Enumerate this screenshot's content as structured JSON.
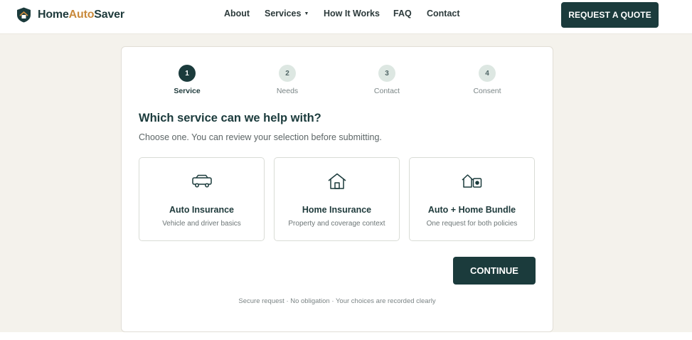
{
  "brand": {
    "name_part1": "Home",
    "name_accent": "Auto",
    "name_part2": "Saver",
    "logo_icon": "shield-house-icon"
  },
  "nav": {
    "items": [
      {
        "label": "About"
      },
      {
        "label": "Services",
        "has_dropdown": true
      },
      {
        "label": "How It Works"
      },
      {
        "label": "FAQ"
      },
      {
        "label": "Contact"
      }
    ],
    "cta_label": "REQUEST A QUOTE"
  },
  "stepper": {
    "current_step": 1,
    "steps": [
      {
        "number": "1",
        "label": "Service"
      },
      {
        "number": "2",
        "label": "Needs"
      },
      {
        "number": "3",
        "label": "Contact"
      },
      {
        "number": "4",
        "label": "Consent"
      }
    ]
  },
  "form": {
    "question": "Which service can we help with?",
    "subtitle": "Choose one. You can review your selection before submitting.",
    "options": [
      {
        "icon": "car-icon",
        "title": "Auto Insurance",
        "description": "Vehicle and driver basics"
      },
      {
        "icon": "house-icon",
        "title": "Home Insurance",
        "description": "Property and coverage context"
      },
      {
        "icon": "house-car-icon",
        "title": "Auto + Home Bundle",
        "description": "One request for both policies"
      }
    ],
    "continue_label": "CONTINUE",
    "footnote": "Secure request · No obligation · Your choices are recorded clearly"
  },
  "colors": {
    "primary": "#1b3b3c",
    "accent": "#c98a3c",
    "background": "#f4f2ec",
    "step_inactive": "#dde7e2"
  }
}
